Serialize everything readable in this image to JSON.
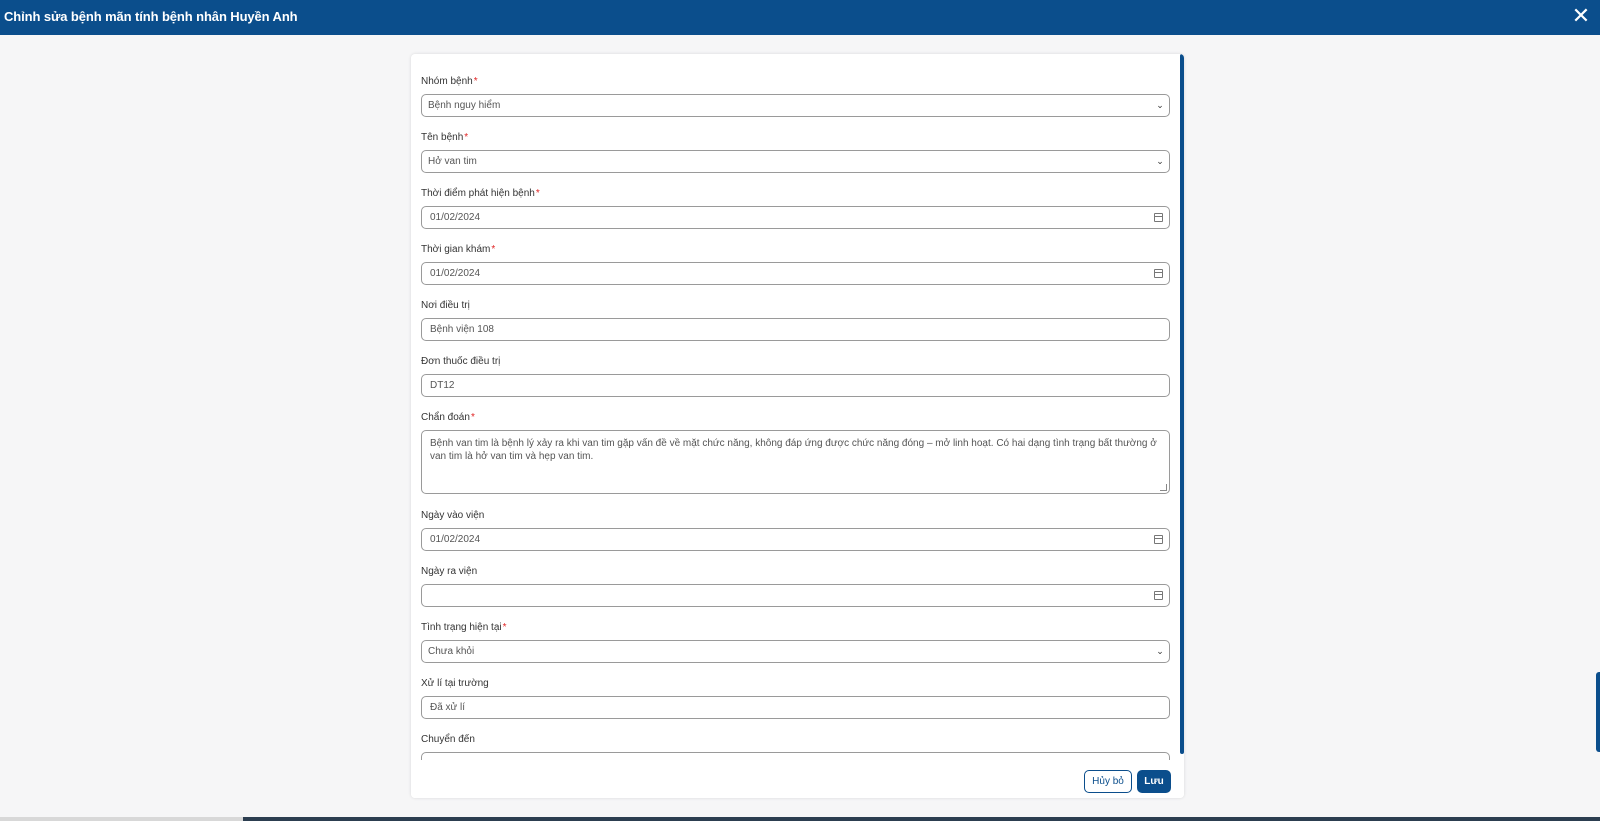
{
  "window": {
    "title": "Chỉnh sửa bệnh mãn tính bệnh nhân Huyền Anh",
    "close_symbol": "✕"
  },
  "form": {
    "nhom_benh": {
      "label": "Nhóm bệnh",
      "required_mark": "*",
      "value": "Bệnh nguy hiểm"
    },
    "ten_benh": {
      "label": "Tên bệnh",
      "required_mark": "*",
      "value": "Hở van tim"
    },
    "thoi_diem_phat_hien": {
      "label": "Thời điểm phát hiện bệnh",
      "required_mark": "*",
      "value": "01/02/2024"
    },
    "thoi_gian_kham": {
      "label": "Thời gian khám",
      "required_mark": "*",
      "value": "01/02/2024"
    },
    "noi_dieu_tri": {
      "label": "Nơi điều trị",
      "value": "Bệnh viện 108"
    },
    "don_thuoc": {
      "label": "Đơn thuốc điều trị",
      "value": "DT12"
    },
    "chan_doan": {
      "label": "Chẩn đoán",
      "required_mark": "*",
      "value": "Bệnh van tim là bệnh lý xảy ra khi van tim gặp vấn đề về mặt chức năng, không đáp ứng được chức năng đóng – mở linh hoạt. Có hai dạng tình trạng bất thường ở van tim là hở van tim và hẹp van tim."
    },
    "ngay_vao_vien": {
      "label": "Ngày vào viện",
      "value": "01/02/2024"
    },
    "ngay_ra_vien": {
      "label": "Ngày ra viện",
      "value": ""
    },
    "tinh_trang": {
      "label": "Tình trạng hiện tại",
      "required_mark": "*",
      "value": "Chưa khỏi"
    },
    "xu_li": {
      "label": "Xử lí tại trường",
      "value": "Đã xử lí"
    },
    "chuyen_den": {
      "label": "Chuyển đến",
      "value": ""
    }
  },
  "actions": {
    "cancel_label": "Hủy bỏ",
    "save_label": "Lưu"
  },
  "icons": {
    "close": "close-icon",
    "dropdown": "chevron-down-icon",
    "date": "calendar-icon"
  },
  "colors": {
    "primary": "#0b4e8c",
    "required": "#e02424"
  }
}
